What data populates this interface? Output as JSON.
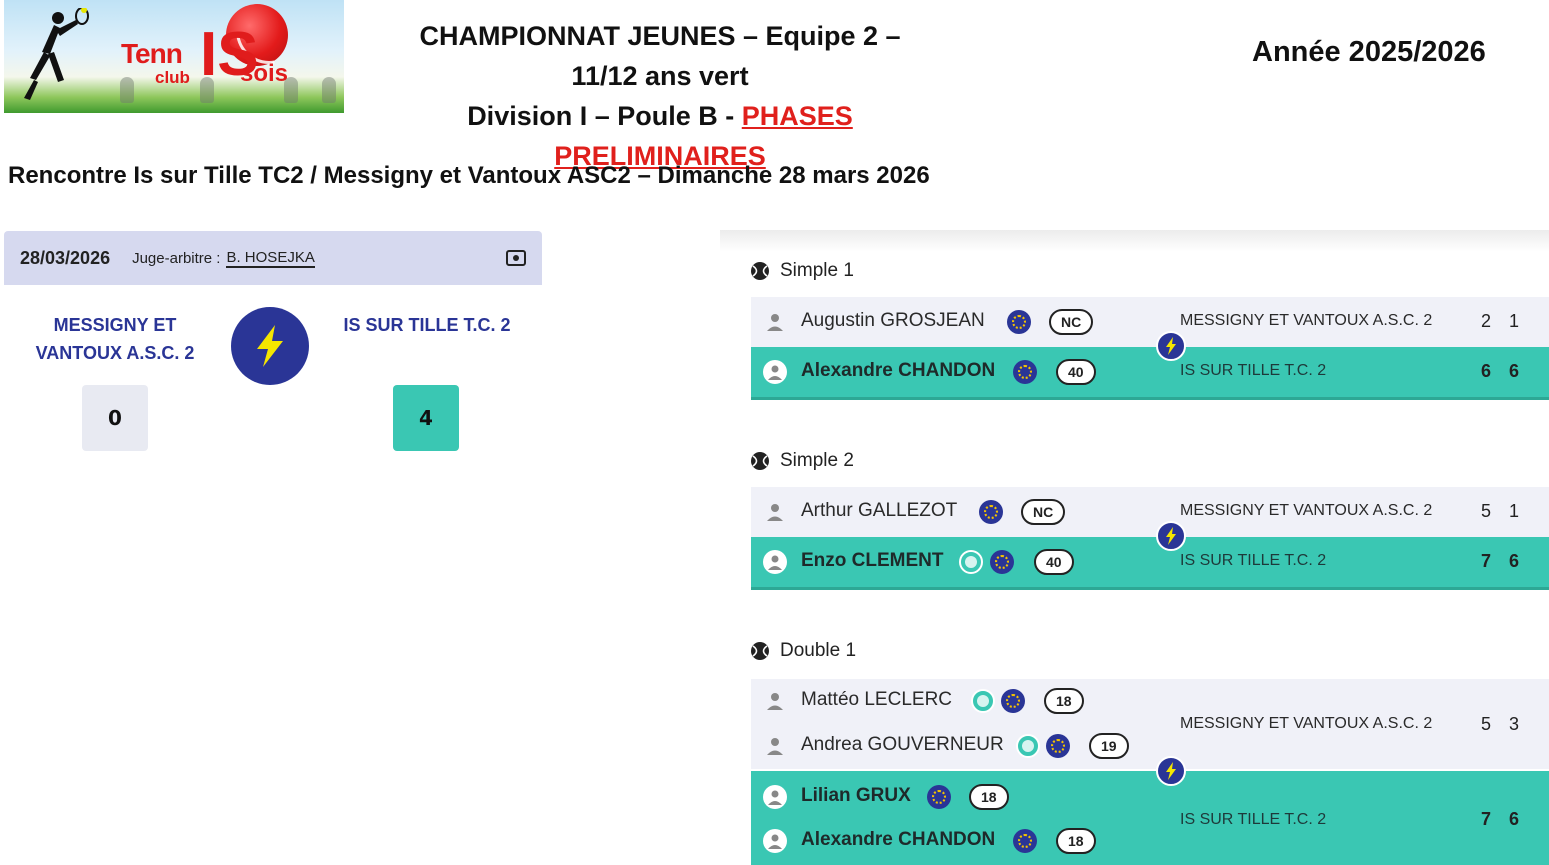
{
  "header": {
    "logo": {
      "text_tenn": "Tenn",
      "text_is": "IS",
      "text_club": "club",
      "text_sois": "sois"
    },
    "title_line1": "CHAMPIONNAT JEUNES – Equipe 2 – 11/12 ans vert",
    "title_line2_prefix": "Division I – Poule B - ",
    "title_line2_phase": "PHASES PRELIMINAIRES",
    "season": "Année 2025/2026",
    "rencontre": "Rencontre Is sur Tille TC2 / Messigny et Vantoux ASC2 – Dimanche 28 mars 2026"
  },
  "match_card": {
    "date": "28/03/2026",
    "judge_label": "Juge-arbitre :",
    "judge_name": "B. HOSEJKA",
    "team_a_line1": "MESSIGNY ET",
    "team_a_line2": "VANTOUX A.S.C. 2",
    "team_b": "IS SUR TILLE T.C. 2",
    "score_a": "0",
    "score_b": "4",
    "icons": {
      "header": "scoresheet-icon",
      "versus": "lightning-icon"
    }
  },
  "matches": [
    {
      "title": "Simple 1",
      "loser": {
        "players": [
          {
            "name": "Augustin GROSJEAN",
            "rank": "NC"
          }
        ],
        "team": "MESSIGNY ET VANTOUX A.S.C. 2",
        "sets": [
          "2",
          "1"
        ]
      },
      "winner": {
        "players": [
          {
            "name": "Alexandre CHANDON",
            "rank": "40"
          }
        ],
        "team": "IS SUR TILLE T.C. 2",
        "sets": [
          "6",
          "6"
        ]
      }
    },
    {
      "title": "Simple 2",
      "loser": {
        "players": [
          {
            "name": "Arthur GALLEZOT",
            "rank": "NC"
          }
        ],
        "team": "MESSIGNY ET VANTOUX A.S.C. 2",
        "sets": [
          "5",
          "1"
        ]
      },
      "winner": {
        "players": [
          {
            "name": "Enzo CLEMENT",
            "rank": "40"
          }
        ],
        "team": "IS SUR TILLE T.C. 2",
        "sets": [
          "7",
          "6"
        ]
      }
    },
    {
      "title": "Double 1",
      "loser": {
        "players": [
          {
            "name": "Mattéo LECLERC",
            "rank": "18"
          },
          {
            "name": "Andrea GOUVERNEUR",
            "rank": "19"
          }
        ],
        "team": "MESSIGNY ET VANTOUX A.S.C. 2",
        "sets": [
          "5",
          "3"
        ]
      },
      "winner": {
        "players": [
          {
            "name": "Lilian GRUX",
            "rank": "18"
          },
          {
            "name": "Alexandre CHANDON",
            "rank": "18"
          }
        ],
        "team": "IS SUR TILLE T.C. 2",
        "sets": [
          "7",
          "6"
        ]
      }
    }
  ],
  "colors": {
    "accent_navy": "#2a3596",
    "winner_teal": "#3ac7b3",
    "loser_row": "#f0f1f8",
    "header_band": "#d6d9ef",
    "phase_red": "#e0201c",
    "bolt_yellow": "#f5e600"
  }
}
